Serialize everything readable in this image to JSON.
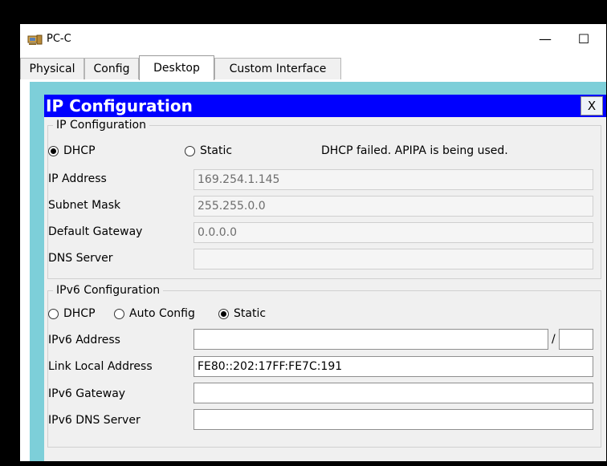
{
  "window": {
    "title": "PC-C",
    "minimize_symbol": "—",
    "maximize_symbol": "☐"
  },
  "tabs": [
    {
      "label": "Physical",
      "active": false
    },
    {
      "label": "Config",
      "active": false
    },
    {
      "label": "Desktop",
      "active": true
    },
    {
      "label": "Custom Interface",
      "active": false
    }
  ],
  "panel": {
    "title": "IP Configuration",
    "close_label": "X"
  },
  "ipv4": {
    "group_title": "IP Configuration",
    "mode_dhcp": "DHCP",
    "mode_static": "Static",
    "selected_mode": "DHCP",
    "status": "DHCP failed. APIPA is being used.",
    "ip_address_label": "IP Address",
    "ip_address": "169.254.1.145",
    "subnet_mask_label": "Subnet Mask",
    "subnet_mask": "255.255.0.0",
    "gateway_label": "Default Gateway",
    "gateway": "0.0.0.0",
    "dns_label": "DNS Server",
    "dns": ""
  },
  "ipv6": {
    "group_title": "IPv6 Configuration",
    "mode_dhcp": "DHCP",
    "mode_auto": "Auto Config",
    "mode_static": "Static",
    "selected_mode": "Static",
    "address_label": "IPv6 Address",
    "address": "",
    "prefix_separator": "/",
    "prefix_length": "",
    "link_local_label": "Link Local Address",
    "link_local": "FE80::202:17FF:FE7C:191",
    "gateway_label": "IPv6 Gateway",
    "gateway": "",
    "dns_label": "IPv6 DNS Server",
    "dns": ""
  },
  "colors": {
    "panel_header": "#0000ff",
    "desktop_background": "#7dcfd9",
    "outer_frame": "#000000"
  },
  "icons": {
    "app": "pc-icon"
  }
}
